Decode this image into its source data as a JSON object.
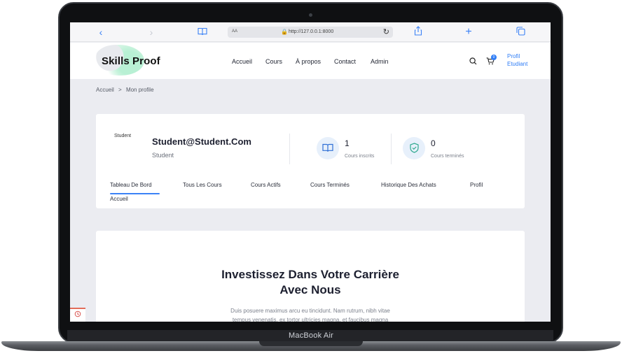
{
  "device": {
    "label": "MacBook Air"
  },
  "browser": {
    "url": "http://127.0.0.1:8000",
    "aa_label": "AA",
    "icons": [
      "back-icon",
      "forward-icon",
      "bookmarks-icon",
      "lock-icon",
      "reload-icon",
      "share-icon",
      "new-tab-icon",
      "tabs-icon"
    ]
  },
  "header": {
    "logo_text": "Skills Proof",
    "nav": [
      "Accueil",
      "Cours",
      "À propos",
      "Contact",
      "Admin"
    ],
    "cart_count": "0",
    "profile_alt": "Profil Etudiant"
  },
  "breadcrumb": {
    "home": "Accueil",
    "separator": ">",
    "current": "Mon profile"
  },
  "profile": {
    "avatar_alt": "Student",
    "email": "Student@Student.Com",
    "role": "Student",
    "stats": [
      {
        "value": "1",
        "label": "Cours inscrits",
        "icon": "book-icon"
      },
      {
        "value": "0",
        "label": "Cours terminés",
        "icon": "shield-check-icon"
      }
    ],
    "tabs": [
      "Tableau De Bord",
      "Tous Les Cours",
      "Cours Actifs",
      "Cours Terminés",
      "Historique Des Achats",
      "Profil"
    ],
    "tab_row2": "Accueil",
    "active_tab": "Tableau De Bord"
  },
  "hero": {
    "title_line1": "Investissez Dans Votre Carrière",
    "title_line2": "Avec Nous",
    "text_line1": "Duis posuere maximus arcu eu tincidunt. Nam rutrum, nibh vitae",
    "text_line2": "tempus venenatis, ex tortor ultricies magna, et faucibus magna"
  },
  "colors": {
    "accent": "#3b82f6",
    "page_bg": "#ebecf1",
    "card_bg": "#ffffff"
  }
}
